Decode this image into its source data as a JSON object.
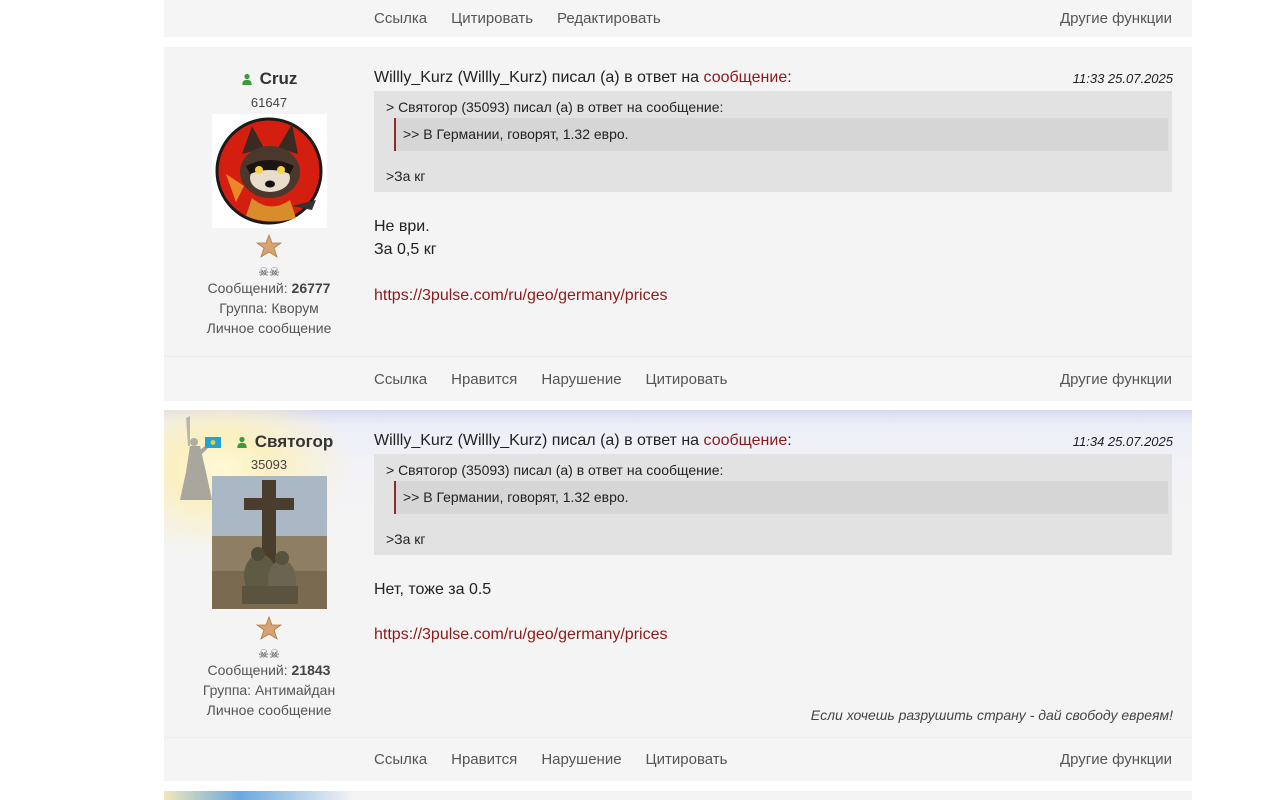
{
  "top_bar": {
    "actions": [
      "Ссылка",
      "Цитировать",
      "Редактировать"
    ],
    "more": "Другие функции"
  },
  "posts": [
    {
      "username": "Cruz",
      "user_id": "61647",
      "messages_label": "Сообщений:",
      "messages_count": "26777",
      "group": "Группа: Кворум",
      "pm": "Личное сообщение",
      "header_prefix": "Willly_Kurz (Willly_Kurz) писал (а) в ответ на ",
      "header_link": "сообщение",
      "header_suffix": ":",
      "date": "11:33 25.07.2025",
      "quote_line": "> Святогор (35093) писал (а) в ответ на сообщение:",
      "quote_inner": ">> В Германии, говорят, 1.32 евро.",
      "quote_tail": ">За кг",
      "body_lines": [
        "Не ври.",
        "За 0,5 кг"
      ],
      "url": "https://3pulse.com/ru/geo/germany/prices",
      "actions": [
        "Ссылка",
        "Нравится",
        "Нарушение",
        "Цитировать"
      ],
      "more": "Другие функции"
    },
    {
      "username": "Святогор",
      "user_id": "35093",
      "messages_label": "Сообщений:",
      "messages_count": "21843",
      "group": "Группа: Антимайдан",
      "pm": "Личное сообщение",
      "header_prefix": "Willly_Kurz (Willly_Kurz) писал (а) в ответ на ",
      "header_link": "сообщение",
      "header_suffix": ":",
      "date": "11:34 25.07.2025",
      "quote_line": "> Святогор (35093) писал (а) в ответ на сообщение:",
      "quote_inner": ">> В Германии, говорят, 1.32 евро.",
      "quote_tail": ">За кг",
      "body_lines": [
        "Нет, тоже за 0.5"
      ],
      "url": "https://3pulse.com/ru/geo/germany/prices",
      "signature": "Если хочешь разрушить страну - дай свободу евреям!",
      "actions": [
        "Ссылка",
        "Нравится",
        "Нарушение",
        "Цитировать"
      ],
      "more": "Другие функции"
    }
  ],
  "colors": {
    "link": "#8b1a1a",
    "online": "#3c9a3c",
    "block_bg": "#f4f4f4"
  }
}
